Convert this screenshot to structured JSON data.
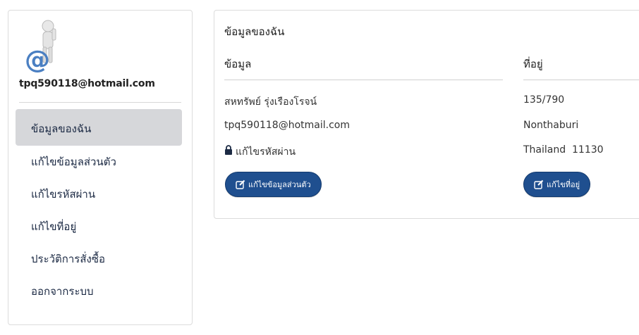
{
  "sidebar": {
    "email": "tpq590118@hotmail.com",
    "items": [
      {
        "label": "ข้อมูลของฉัน",
        "active": true
      },
      {
        "label": "แก้ไขข้อมูลส่วนตัว",
        "active": false
      },
      {
        "label": "แก้ไขรหัสผ่าน",
        "active": false
      },
      {
        "label": "แก้ไขที่อยู่",
        "active": false
      },
      {
        "label": "ประวัติการสั่งซื้อ",
        "active": false
      },
      {
        "label": "ออกจากระบบ",
        "active": false
      }
    ]
  },
  "panel": {
    "title": "ข้อมูลของฉัน",
    "info": {
      "heading": "ข้อมูล",
      "name": "สหทรัพย์ รุ่งเรืองโรจน์",
      "email": "tpq590118@hotmail.com",
      "change_password": "แก้ไขรหัสผ่าน",
      "edit_button": "แก้ไขข้อมูลส่วนตัว"
    },
    "address": {
      "heading": "ที่อยู่",
      "line1": "135/790",
      "line2": "Nonthaburi",
      "line3": "Thailand  11130",
      "edit_button": "แก้ไขที่อยู่"
    }
  },
  "colors": {
    "button": "#1f4f8f",
    "active_menu": "#d6d7da"
  }
}
